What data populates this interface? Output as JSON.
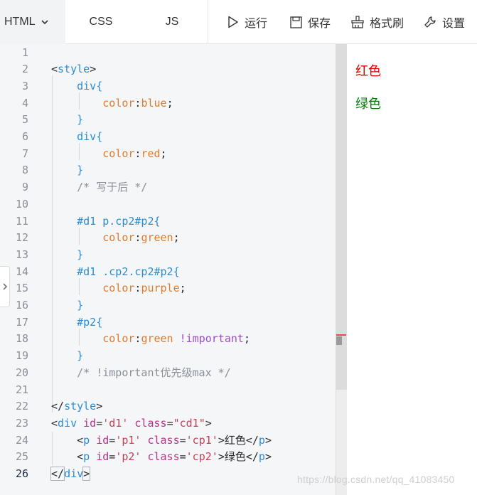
{
  "tabs": {
    "html": "HTML",
    "css": "CSS",
    "js": "JS"
  },
  "tools": {
    "run": "运行",
    "save": "保存",
    "format": "格式刷",
    "settings": "设置"
  },
  "editor": {
    "line_numbers": [
      "1",
      "2",
      "3",
      "4",
      "5",
      "6",
      "7",
      "8",
      "9",
      "10",
      "11",
      "12",
      "13",
      "14",
      "15",
      "16",
      "17",
      "18",
      "19",
      "20",
      "21",
      "22",
      "23",
      "24",
      "25",
      "26"
    ],
    "active_line": "26",
    "lines": [
      [],
      [
        {
          "t": "<",
          "c": "t-punc"
        },
        {
          "t": "style",
          "c": "t-tag"
        },
        {
          "t": ">",
          "c": "t-punc"
        }
      ],
      [
        {
          "t": "    div{",
          "c": "t-sel"
        }
      ],
      [
        {
          "t": "        color",
          "c": "t-prop"
        },
        {
          "t": ":",
          "c": "t-punc"
        },
        {
          "t": "blue",
          "c": "t-val"
        },
        {
          "t": ";",
          "c": "t-punc"
        }
      ],
      [
        {
          "t": "    }",
          "c": "t-sel"
        }
      ],
      [
        {
          "t": "    div{",
          "c": "t-sel"
        }
      ],
      [
        {
          "t": "        color",
          "c": "t-prop"
        },
        {
          "t": ":",
          "c": "t-punc"
        },
        {
          "t": "red",
          "c": "t-val"
        },
        {
          "t": ";",
          "c": "t-punc"
        }
      ],
      [
        {
          "t": "    }",
          "c": "t-sel"
        }
      ],
      [
        {
          "t": "    /* 写于后 */",
          "c": "t-com"
        }
      ],
      [],
      [
        {
          "t": "    #d1 p.cp2#p2{",
          "c": "t-sel"
        }
      ],
      [
        {
          "t": "        color",
          "c": "t-prop"
        },
        {
          "t": ":",
          "c": "t-punc"
        },
        {
          "t": "green",
          "c": "t-val"
        },
        {
          "t": ";",
          "c": "t-punc"
        }
      ],
      [
        {
          "t": "    }",
          "c": "t-sel"
        }
      ],
      [
        {
          "t": "    #d1 .cp2.cp2#p2{",
          "c": "t-sel"
        }
      ],
      [
        {
          "t": "        color",
          "c": "t-prop"
        },
        {
          "t": ":",
          "c": "t-punc"
        },
        {
          "t": "purple",
          "c": "t-val"
        },
        {
          "t": ";",
          "c": "t-punc"
        }
      ],
      [
        {
          "t": "    }",
          "c": "t-sel"
        }
      ],
      [
        {
          "t": "    #p2{",
          "c": "t-sel"
        }
      ],
      [
        {
          "t": "        color",
          "c": "t-prop"
        },
        {
          "t": ":",
          "c": "t-punc"
        },
        {
          "t": "green ",
          "c": "t-val"
        },
        {
          "t": "!important",
          "c": "t-imp"
        },
        {
          "t": ";",
          "c": "t-punc"
        }
      ],
      [
        {
          "t": "    }",
          "c": "t-sel"
        }
      ],
      [
        {
          "t": "    /* !important优先级max */",
          "c": "t-com"
        }
      ],
      [],
      [
        {
          "t": "</",
          "c": "t-punc"
        },
        {
          "t": "style",
          "c": "t-tag"
        },
        {
          "t": ">",
          "c": "t-punc"
        }
      ],
      [
        {
          "t": "<",
          "c": "t-punc"
        },
        {
          "t": "div ",
          "c": "t-tag"
        },
        {
          "t": "id",
          "c": "t-attr"
        },
        {
          "t": "=",
          "c": "t-punc"
        },
        {
          "t": "'d1' ",
          "c": "t-str"
        },
        {
          "t": "class",
          "c": "t-attr"
        },
        {
          "t": "=",
          "c": "t-punc"
        },
        {
          "t": "\"cd1\"",
          "c": "t-str"
        },
        {
          "t": ">",
          "c": "t-punc"
        }
      ],
      [
        {
          "t": "    <",
          "c": "t-punc"
        },
        {
          "t": "p ",
          "c": "t-tag"
        },
        {
          "t": "id",
          "c": "t-attr"
        },
        {
          "t": "=",
          "c": "t-punc"
        },
        {
          "t": "'p1' ",
          "c": "t-str"
        },
        {
          "t": "class",
          "c": "t-attr"
        },
        {
          "t": "=",
          "c": "t-punc"
        },
        {
          "t": "'cp1'",
          "c": "t-str"
        },
        {
          "t": ">红色</",
          "c": "t-txt"
        },
        {
          "t": "p",
          "c": "t-tag"
        },
        {
          "t": ">",
          "c": "t-punc"
        }
      ],
      [
        {
          "t": "    <",
          "c": "t-punc"
        },
        {
          "t": "p ",
          "c": "t-tag"
        },
        {
          "t": "id",
          "c": "t-attr"
        },
        {
          "t": "=",
          "c": "t-punc"
        },
        {
          "t": "'p2' ",
          "c": "t-str"
        },
        {
          "t": "class",
          "c": "t-attr"
        },
        {
          "t": "=",
          "c": "t-punc"
        },
        {
          "t": "'cp2'",
          "c": "t-str"
        },
        {
          "t": ">绿色</",
          "c": "t-txt"
        },
        {
          "t": "p",
          "c": "t-tag"
        },
        {
          "t": ">",
          "c": "t-punc"
        }
      ],
      [
        {
          "t": "</",
          "c": "t-punc"
        },
        {
          "t": "div",
          "c": "t-tag"
        },
        {
          "t": ">",
          "c": "t-punc"
        }
      ]
    ]
  },
  "preview": {
    "p1": "红色",
    "p2": "绿色",
    "p1_color": "#e00000",
    "p2_color": "#008000"
  },
  "watermark": "https://blog.csdn.net/qq_41083450",
  "icons": {
    "html_dropdown": "chevron-down-icon",
    "run": "play-icon",
    "save": "save-icon",
    "format": "format-brush-icon",
    "settings": "wrench-icon",
    "side_toggle": "chevron-right-icon"
  }
}
